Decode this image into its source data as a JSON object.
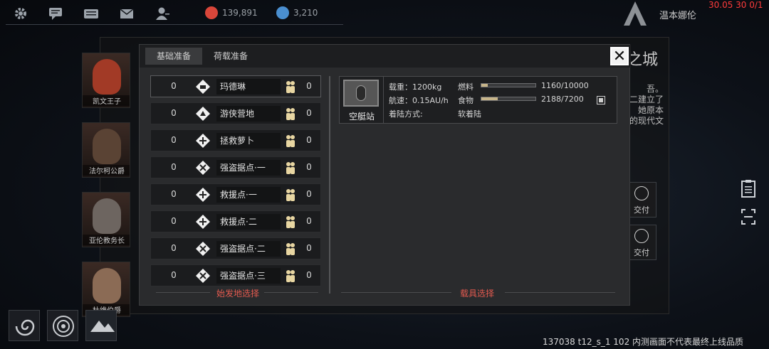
{
  "topbar": {
    "icons": [
      "gear-icon",
      "chat-icon",
      "keyboard-icon",
      "mail-icon",
      "friends-icon"
    ],
    "resources": [
      {
        "name": "coin-icon",
        "value": "139,891",
        "color": "#d9463a"
      },
      {
        "name": "gem-icon",
        "value": "3,210",
        "color": "#4a8fd0"
      }
    ],
    "player_name": "温本娜伦",
    "debug_info": "30.05 30 0/1"
  },
  "background": {
    "city_title": "之城",
    "city_text": [
      "吾。",
      "二建立了",
      "她原本",
      "的现代文"
    ],
    "deliver_label": "交付",
    "characters": [
      {
        "name": "凯文王子",
        "color": "#a23a26"
      },
      {
        "name": "法尔柯公爵",
        "color": "#5a4334"
      },
      {
        "name": "亚伦教务长",
        "color": "#6d6560"
      },
      {
        "name": "杜维伯爵",
        "color": "#8b6b55"
      }
    ]
  },
  "dialog": {
    "tabs": [
      "基础准备",
      "荷载准备"
    ],
    "active_tab": 0,
    "close_label": "✕",
    "locations": [
      {
        "left": "0",
        "name": "玛德琳",
        "right": "0",
        "selected": true
      },
      {
        "left": "0",
        "name": "游侠营地",
        "right": "0"
      },
      {
        "left": "0",
        "name": "拯救萝卜",
        "right": "0"
      },
      {
        "left": "0",
        "name": "强盗据点·一",
        "right": "0"
      },
      {
        "left": "0",
        "name": "救援点·一",
        "right": "0"
      },
      {
        "left": "0",
        "name": "救援点·二",
        "right": "0"
      },
      {
        "left": "0",
        "name": "强盗据点·二",
        "right": "0"
      },
      {
        "left": "0",
        "name": "强盗据点·三",
        "right": "0"
      }
    ],
    "origin_label": "始发地选择",
    "vehicle_label": "载具选择",
    "vehicle": {
      "name": "空艇站",
      "load_label": "载重：",
      "load_value": "1200kg",
      "speed_label": "航速：",
      "speed_value": "0.15AU/h",
      "landing_label": "着陆方式:",
      "landing_value": "软着陆",
      "fuel_label": "燃料",
      "fuel_value": "1160/10000",
      "fuel_fraction": 0.116,
      "food_label": "食物",
      "food_value": "2188/7200",
      "food_fraction": 0.304
    }
  },
  "watermark": "137038 t12_s_1 102  内测画面不代表最终上线品质"
}
